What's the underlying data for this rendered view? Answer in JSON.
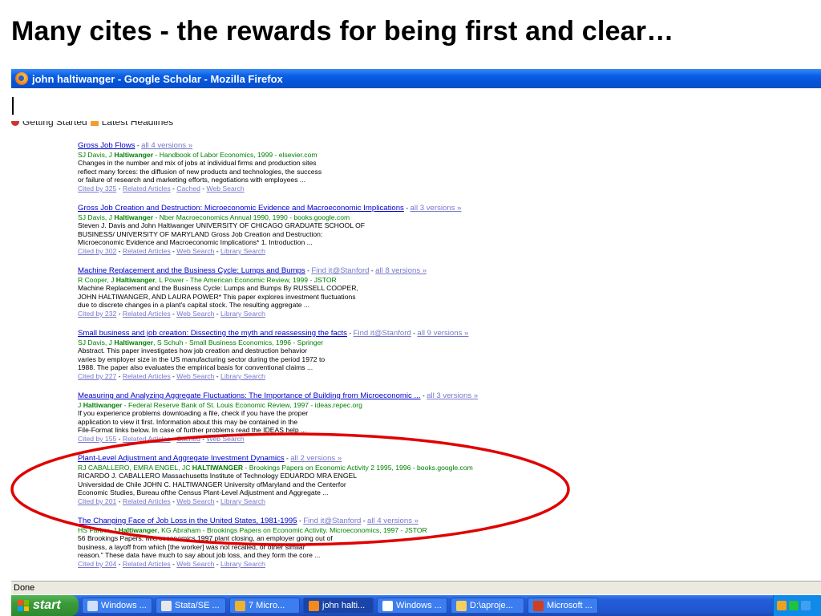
{
  "slide_title": "Many cites - the rewards for being first and clear…",
  "window": {
    "title": "john haltiwanger - Google Scholar - Mozilla Firefox"
  },
  "bookmarks": {
    "getting_started": "Getting Started",
    "latest_headlines": "Latest Headlines"
  },
  "results": [
    {
      "title": "Gross Job Flows",
      "extras": [
        "all 4 versions »"
      ],
      "authors_pre": "SJ Davis, J ",
      "authors_bold": "Haltiwanger",
      "authors_post": " - Handbook of Labor Economics, 1999 - elsevier.com",
      "snippet": [
        "Changes in the number and mix of jobs at individual firms and production sites",
        "reflect many forces: the diffusion of new products and technologies, the success",
        "or failure of research and marketing efforts, negotiations with employees ..."
      ],
      "links": [
        "Cited by 325",
        "Related Articles",
        "Cached",
        "Web Search"
      ]
    },
    {
      "title": "Gross Job Creation and Destruction: Microeconomic Evidence and Macroeconomic Implications",
      "extras": [
        "all 3 versions »"
      ],
      "authors_pre": "SJ Davis, J ",
      "authors_bold": "Haltiwanger",
      "authors_post": " - Nber Macroeconomics Annual 1990, 1990 - books.google.com",
      "snippet": [
        "Steven J. Davis and John Haltiwanger UNIVERSITY OF CHICAGO GRADUATE SCHOOL OF",
        "BUSINESS/ UNIVERSITY OF MARYLAND Gross Job Creation and Destruction:",
        "Microeconomic Evidence and Macroeconomic Implications* 1. Introduction ..."
      ],
      "links": [
        "Cited by 302",
        "Related Articles",
        "Web Search",
        "Library Search"
      ]
    },
    {
      "title": "Machine Replacement and the Business Cycle: Lumps and Bumps",
      "extras": [
        "Find it@Stanford",
        "all 8 versions »"
      ],
      "authors_pre": "R Cooper, J ",
      "authors_bold": "Haltiwanger",
      "authors_post": ", L Power - The American Economic Review, 1999 - JSTOR",
      "snippet": [
        "Machine Replacement and the Business Cycle: Lumps and Bumps By RUSSELL COOPER,",
        "JOHN HALTIWANGER, AND LAURA POWER* This paper explores investment fluctuations",
        "due to discrete changes in a plant's capital stock. The resulting aggregate ..."
      ],
      "links": [
        "Cited by 232",
        "Related Articles",
        "Web Search",
        "Library Search"
      ]
    },
    {
      "title": "Small business and job creation: Dissecting the myth and reassessing the facts",
      "extras": [
        "Find it@Stanford",
        "all 9 versions »"
      ],
      "authors_pre": "SJ Davis, J ",
      "authors_bold": "Haltiwanger",
      "authors_post": ", S Schuh - Small Business Economics, 1996 - Springer",
      "snippet": [
        "Abstract. This paper investigates how job creation and destruction behavior",
        "varies by employer size in the US manufacturing sector during the period 1972 to",
        "1988. The paper also evaluates the empirical basis for conventional claims ..."
      ],
      "links": [
        "Cited by 227",
        "Related Articles",
        "Web Search",
        "Library Search"
      ]
    },
    {
      "title": "Measuring and Analyzing Aggregate Fluctuations: The Importance of Building from Microeconomic ...",
      "extras": [
        "all 3 versions »"
      ],
      "authors_pre": "J ",
      "authors_bold": "Haltiwanger",
      "authors_post": " - Federal Reserve Bank of St. Louis Economic Review, 1997 - ideas.repec.org",
      "snippet": [
        "If you experience problems downloading a file, check if you have the proper",
        "application to view it first. Information about this may be contained in the",
        "File-Format links below. In case of further problems read the IDEAS help ..."
      ],
      "links": [
        "Cited by 155",
        "Related Articles",
        "Cached",
        "Web Search"
      ]
    },
    {
      "title": "Plant-Level Adjustment and Aggregate Investment Dynamics",
      "extras": [
        "all 2 versions »"
      ],
      "authors_pre": "RJ CABALLERO, EMRA ENGEL, JC ",
      "authors_bold": "HALTIWANGER",
      "authors_post": " - Brookings Papers on Economic Activity 2 1995, 1996 - books.google.com",
      "snippet": [
        "RICARDO J. CABALLERO Massachusetts Institute of Technology EDUARDO MRA ENGEL",
        "Universidad de Chile JOHN C. HALTIWANGER University ofMaryland and the Centerfor",
        "Economic Studies, Bureau ofthe Census Plant-Level Adjustment and Aggregate ..."
      ],
      "links": [
        "Cited by 201",
        "Related Articles",
        "Web Search",
        "Library Search"
      ]
    },
    {
      "title": "The Changing Face of Job Loss in the United States, 1981-1995",
      "extras": [
        "Find it@Stanford",
        "all 4 versions »"
      ],
      "authors_pre": "HS Farber, J ",
      "authors_bold": "Haltiwanger",
      "authors_post": ", KG Abraham - Brookings Papers on Economic Activity. Microeconomics, 1997 - JSTOR",
      "snippet": [
        "56 Brookings Papers: Microeconomics 1997 plant closing, an employer going out of",
        "business, a layoff from which [the worker] was not recalled, or other similar",
        "reason.\" These data have much to say about job loss, and they form the core ..."
      ],
      "links": [
        "Cited by 204",
        "Related Articles",
        "Web Search",
        "Library Search"
      ]
    }
  ],
  "status": "Done",
  "taskbar": {
    "start": "start",
    "tasks": [
      {
        "label": "Windows ...",
        "color": "#d0e0f8"
      },
      {
        "label": "Stata/SE ...",
        "color": "#e8e8e8"
      },
      {
        "label": "7 Micro...",
        "color": "#f0b030"
      },
      {
        "label": "john halti...",
        "color": "#f48a1c"
      },
      {
        "label": "Windows ...",
        "color": "#ffffff"
      },
      {
        "label": "D:\\aproje...",
        "color": "#f4d060"
      },
      {
        "label": "Microsoft ...",
        "color": "#d04020"
      }
    ]
  },
  "colors": {
    "annotation": "#e00000",
    "link": "#0000cc",
    "visited": "#7777cc",
    "author": "#008000",
    "titlebar": "#0453d8"
  }
}
